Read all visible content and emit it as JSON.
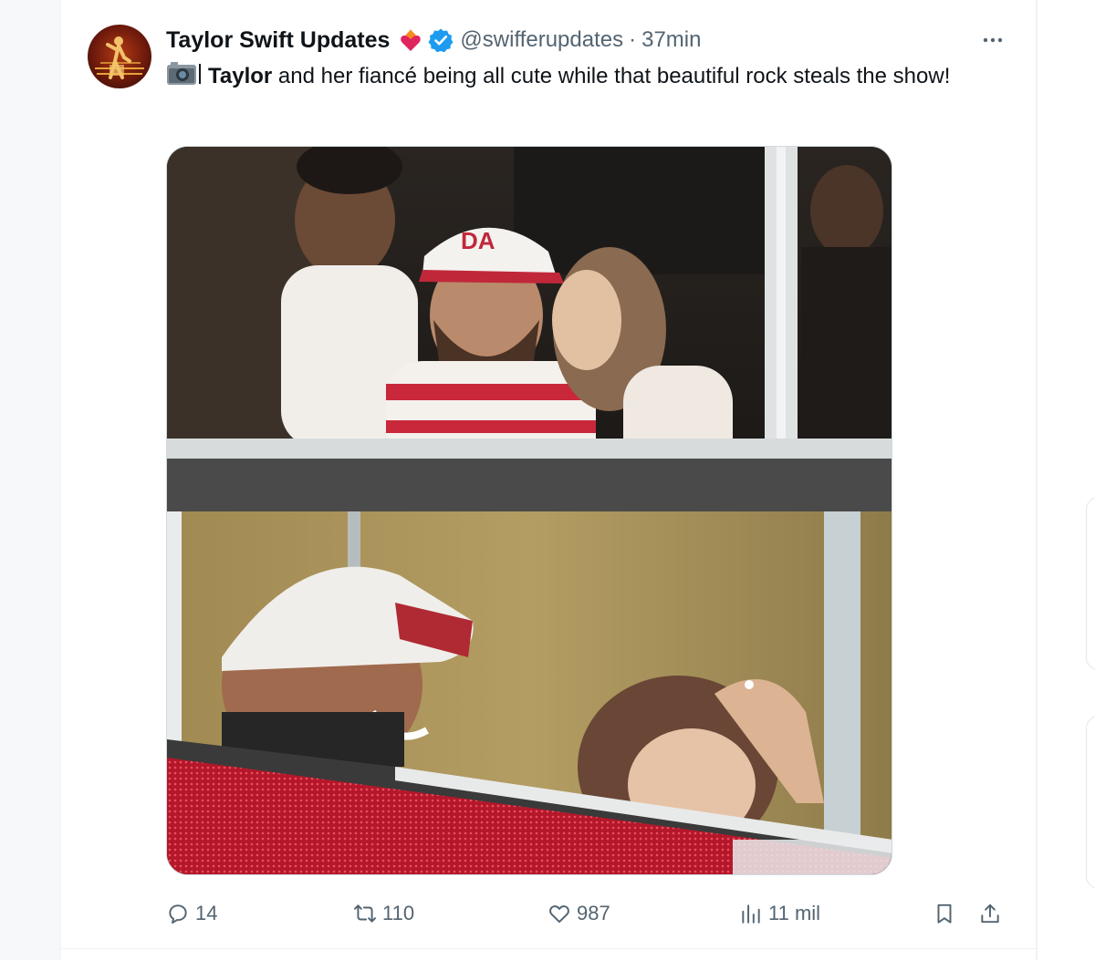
{
  "tweet": {
    "display_name": "Taylor Swift Updates",
    "handle": "@swifferupdates",
    "separator": "·",
    "time": "37min",
    "text_bold": "Taylor",
    "text_rest": " and her fiancé being all cute while that beautiful rock steals the show!",
    "icons": {
      "badge": "heart-on-fire-icon",
      "verified": "verified-badge-icon",
      "prefix": "camera-icon",
      "more": "more-icon"
    }
  },
  "actions": {
    "replies": "14",
    "reposts": "110",
    "likes": "987",
    "views": "11 mil",
    "icons": [
      "reply-icon",
      "repost-icon",
      "like-icon",
      "views-icon",
      "bookmark-icon",
      "share-icon"
    ]
  },
  "colors": {
    "verified": "#1d9bf0",
    "secondary_text": "#536471",
    "primary_text": "#0f1419"
  }
}
